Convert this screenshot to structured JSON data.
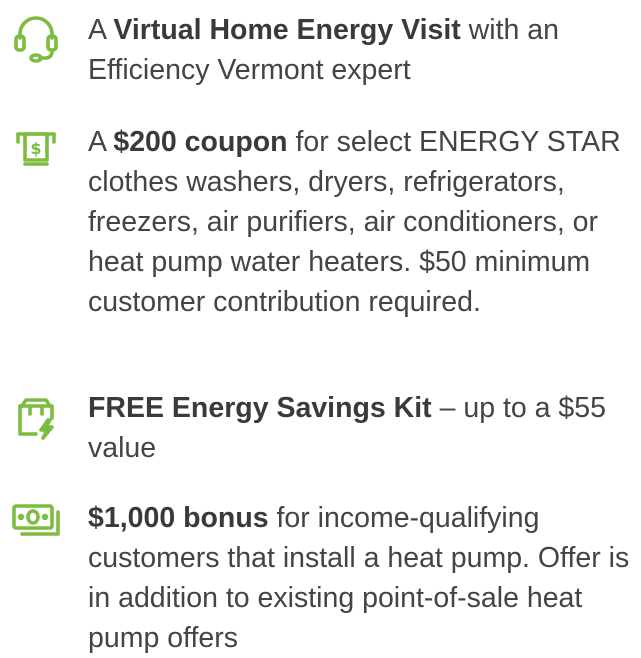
{
  "accent_color": "#7cbd3f",
  "items": [
    {
      "icon": "headset-icon",
      "prefix": "A ",
      "bold": "Virtual Home Energy Visit",
      "suffix": " with an Efficiency Vermont expert"
    },
    {
      "icon": "atm-cash-icon",
      "prefix": "A ",
      "bold": "$200 coupon",
      "suffix": " for select ENERGY STAR clothes washers, dryers, refrigerators, freezers, air purifiers, air conditioners, or heat pump water heaters. $50 minimum customer contribution required."
    },
    {
      "icon": "energy-kit-box-icon",
      "prefix": "",
      "bold": "FREE Energy Savings Kit",
      "suffix": " – up to a $55 value"
    },
    {
      "icon": "cash-bill-icon",
      "prefix": "",
      "bold": "$1,000 bonus",
      "suffix": " for income-qualifying customers that install a heat pump. Offer is in addition to existing point-of-sale heat pump offers"
    }
  ]
}
